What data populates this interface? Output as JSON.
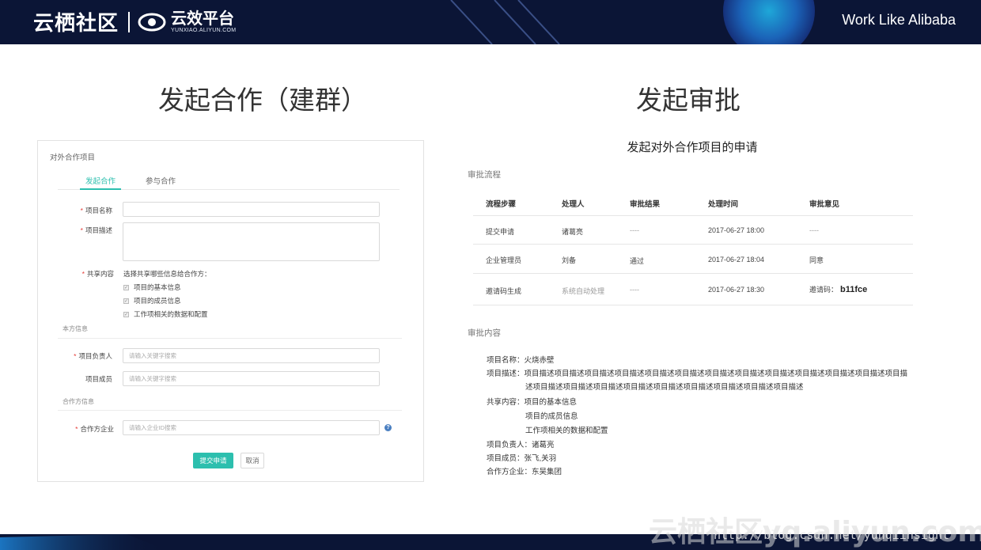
{
  "header": {
    "brand": "云栖社区",
    "product_name": "云效平台",
    "product_domain": "YUNXIAO.ALIYUN.COM",
    "slogan": "Work Like Alibaba"
  },
  "left_title": "发起合作（建群）",
  "right_title": "发起审批",
  "form": {
    "panel_title": "对外合作项目",
    "tabs": [
      {
        "label": "发起合作",
        "active": true
      },
      {
        "label": "参与合作",
        "active": false
      }
    ],
    "required_mark": "*",
    "project_name_label": "项目名称",
    "project_desc_label": "项目描述",
    "share_label": "共享内容",
    "share_hint": "选择共享哪些信息给合作方：",
    "share_options": [
      "项目的基本信息",
      "项目的成员信息",
      "工作项相关的数据和配置"
    ],
    "our_info_heading": "本方信息",
    "owner_label": "项目负责人",
    "owner_placeholder": "请输入关键字搜索",
    "members_label": "项目成员",
    "members_placeholder": "请输入关键字搜索",
    "partner_info_heading": "合作方信息",
    "partner_label": "合作方企业",
    "partner_placeholder": "请输入企业ID搜索",
    "submit_label": "提交申请",
    "cancel_label": "取消",
    "help_glyph": "?"
  },
  "approval": {
    "title": "发起对外合作项目的申请",
    "flow_heading": "审批流程",
    "columns": [
      "流程步骤",
      "处理人",
      "审批结果",
      "处理时间",
      "审批意见"
    ],
    "rows": [
      {
        "step": "提交申请",
        "handler": "诸葛亮",
        "result": "----",
        "time": "2017-06-27 18:00",
        "opinion": "----"
      },
      {
        "step": "企业管理员",
        "handler": "刘备",
        "result": "通过",
        "time": "2017-06-27 18:04",
        "opinion": "同意"
      },
      {
        "step": "邀请码生成",
        "handler": "系统自动处理",
        "result": "----",
        "time": "2017-06-27 18:30",
        "opinion": "邀请码：",
        "code": "b11fce"
      }
    ],
    "content_heading": "审批内容",
    "details": {
      "name_line": "项目名称：火烧赤壁",
      "desc_line1": "项目描述：项目描述项目描述项目描述项目描述项目描述项目描述项目描述项目描述项目描述项目描述项目描述项目描述项目描",
      "desc_line2": "述项目描述项目描述项目描述项目描述项目描述项目描述项目描述项目描述项目描述",
      "share_line": "共享内容：项目的基本信息",
      "share_line2": "项目的成员信息",
      "share_line3": "工作项相关的数据和配置",
      "owner_line": "项目负责人：诸葛亮",
      "members_line": "项目成员：张飞,关羽",
      "partner_line": "合作方企业：东吴集团"
    }
  },
  "watermark": {
    "brand_text": "云栖社区yq.aliyun.com",
    "url_text": "http://blog.csdn.net/yunqiinsight"
  },
  "colors": {
    "header_bg": "#0b1536",
    "accent_teal": "#2cbfae",
    "required_red": "#e53935",
    "help_blue": "#4a7fc1"
  },
  "icons": [
    "cloud-logo-icon",
    "help-icon",
    "checkbox-checked-icon"
  ]
}
